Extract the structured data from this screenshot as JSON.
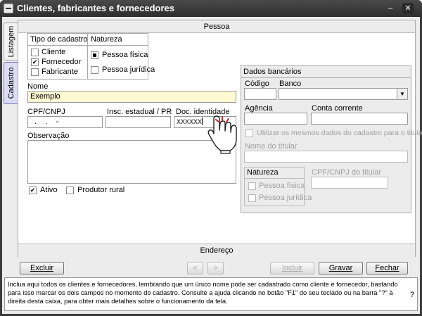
{
  "window": {
    "title": "Clientes, fabricantes e fornecedores",
    "minimize": "–",
    "close": "✕"
  },
  "side_tabs": {
    "listagem": "Listagem",
    "cadastro": "Cadastro"
  },
  "sections": {
    "pessoa": "Pessoa",
    "endereco": "Endereço"
  },
  "tipo_cadastro": {
    "header": "Tipo de cadastro",
    "items": [
      {
        "label": "Cliente",
        "checked": false
      },
      {
        "label": "Fornecedor",
        "checked": true
      },
      {
        "label": "Fabricante",
        "checked": false
      }
    ]
  },
  "natureza": {
    "header": "Natureza",
    "items": [
      {
        "label": "Pessoa física",
        "selected": true
      },
      {
        "label": "Pessoa jurídica",
        "selected": false
      }
    ]
  },
  "fields": {
    "nome_label": "Nome",
    "nome_value": "Exemplo",
    "cpf_label": "CPF/CNPJ",
    "cpf_value": "  .    .    -",
    "insc_label": "Insc. estadual / PR",
    "insc_value": "",
    "doc_label": "Doc. identidade",
    "doc_value": "XXXXXX",
    "obs_label": "Observação",
    "obs_value": ""
  },
  "flags": {
    "ativo": {
      "label": "Ativo",
      "checked": true
    },
    "produtor": {
      "label": "Produtor rural",
      "checked": false
    }
  },
  "dados_bancarios": {
    "header": "Dados bancários",
    "codigo_label": "Código",
    "banco_label": "Banco",
    "agencia_label": "Agência",
    "conta_label": "Conta corrente",
    "usar_mesmos_label": "Utilizar os mesmos dados do cadastro para o titular",
    "nome_titular_label": "Nome do titular",
    "natureza_header": "Natureza",
    "pessoa_fisica": "Pessoa física",
    "pessoa_juridica": "Pessoa jurídica",
    "cpf_titular_label": "CPF/CNPJ do titular"
  },
  "buttons": {
    "excluir": "Excluir",
    "prev": "<",
    "next": ">",
    "incluir": "Incluir",
    "gravar": "Gravar",
    "fechar": "Fechar"
  },
  "help": {
    "text": "Inclua aqui todos os clientes e fornecedores, lembrando que um único nome pode ser cadastrado como cliente e fornecedor, bastando para isso marcar os dois campos no momento do cadastro. Consulte a ajuda clicando no botão \"F1\" do seu teclado ou na barra \"?\" à direita desta caixa, para obter mais detalhes sobre o funcionamento da tela.",
    "question": "?"
  },
  "icons": {
    "cursor": "hand-pointer-icon"
  }
}
